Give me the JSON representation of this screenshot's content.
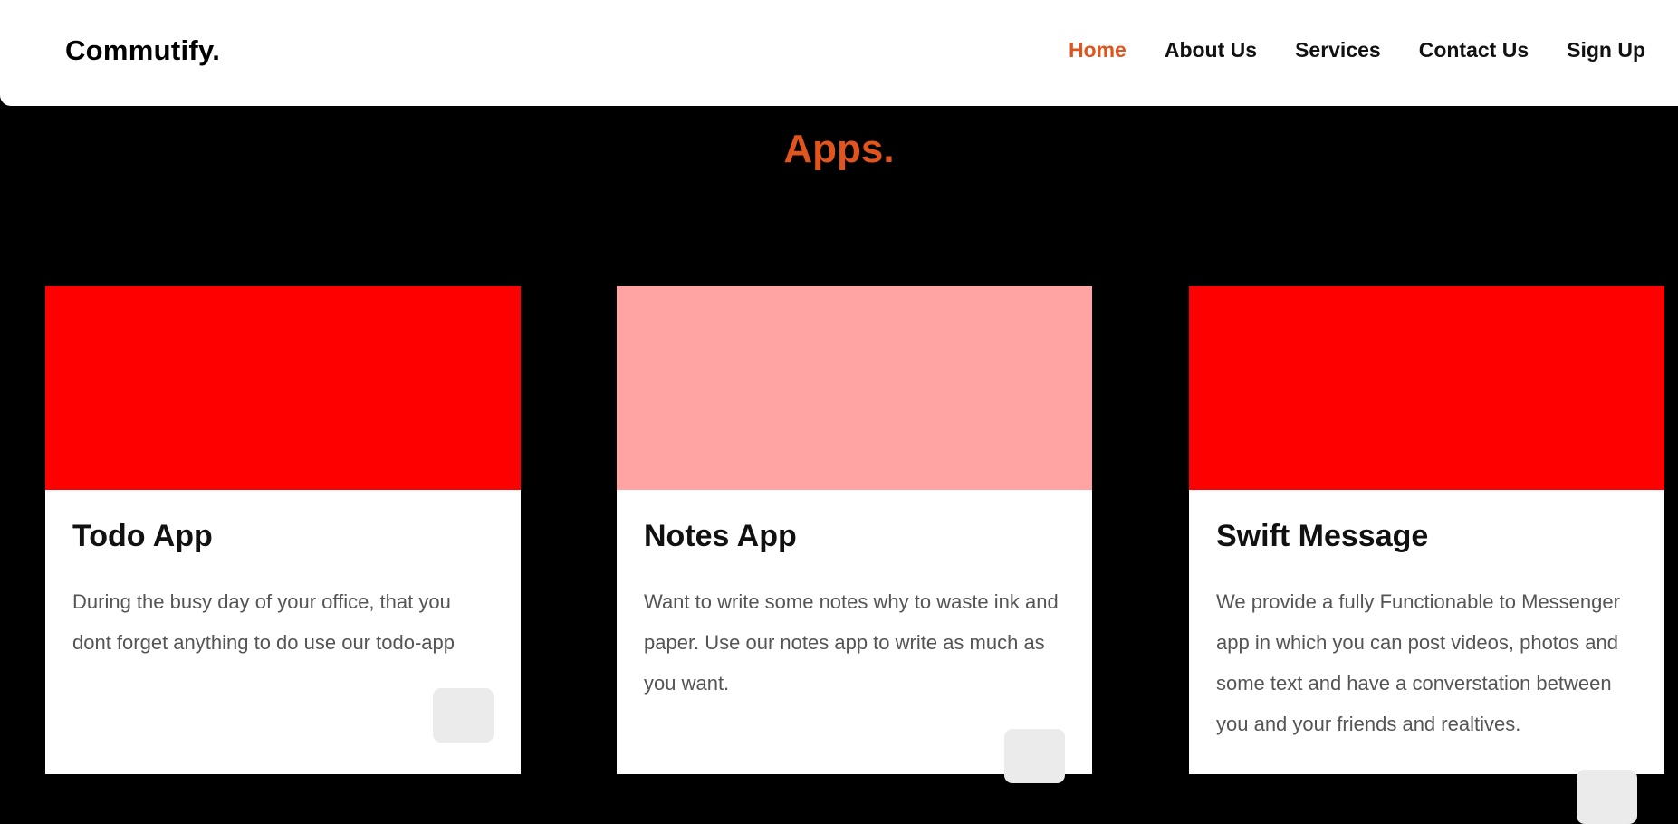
{
  "brand": "Commutify.",
  "nav": {
    "items": [
      {
        "label": "Home",
        "active": true
      },
      {
        "label": "About Us",
        "active": false
      },
      {
        "label": "Services",
        "active": false
      },
      {
        "label": "Contact Us",
        "active": false
      },
      {
        "label": "Sign Up",
        "active": false
      }
    ]
  },
  "section": {
    "title": "Apps."
  },
  "cards": [
    {
      "title": "Todo App",
      "description": "During the busy day of your office, that you dont forget anything to do use our todo-app",
      "image_color": "#ff0000"
    },
    {
      "title": "Notes App",
      "description": "Want to write some notes why to waste ink and paper. Use our notes app to write as much as you want.",
      "image_color": "#ffa3a3"
    },
    {
      "title": "Swift Message",
      "description": "We provide a fully Functionable to Messenger app in which you can post videos, photos and some text and have a converstation between you and your friends and realtives.",
      "image_color": "#ff0000"
    }
  ],
  "colors": {
    "accent": "#e0541e",
    "background": "#000000",
    "card_background": "#ffffff",
    "button_background": "#ebebeb"
  }
}
